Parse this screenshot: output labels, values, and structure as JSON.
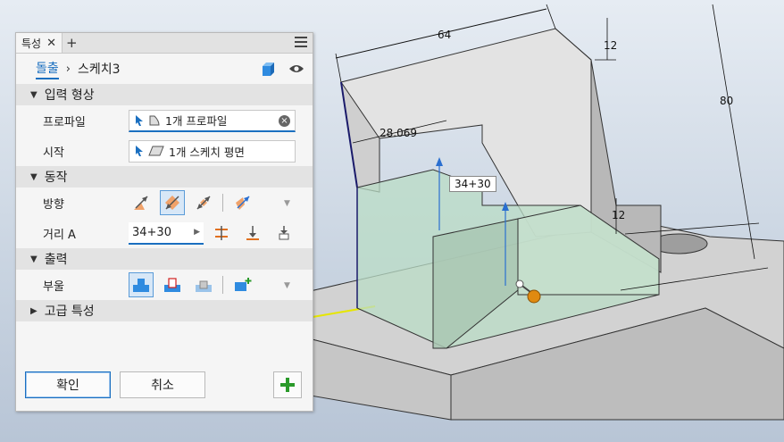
{
  "panel": {
    "tab_label": "특성",
    "close_glyph": "✕",
    "add_tab_glyph": "+",
    "breadcrumb": {
      "feature": "돌출",
      "separator": "›",
      "sketch": "스케치3"
    }
  },
  "sections": {
    "input_geometry": "입력 형상",
    "behavior": "동작",
    "output": "출력",
    "advanced": "고급 특성"
  },
  "input_geometry": {
    "profile_label": "프로파일",
    "profile_value": "1개 프로파일",
    "start_label": "시작",
    "start_value": "1개 스케치 평면"
  },
  "behavior": {
    "direction_label": "방향",
    "distance_label": "거리 A",
    "distance_value": "34+30"
  },
  "output": {
    "boolean_label": "부울"
  },
  "footer": {
    "ok_label": "확인",
    "cancel_label": "취소",
    "add_glyph": "+"
  },
  "viewport": {
    "dims": {
      "width_top": "64",
      "top_thickness": "12",
      "overall_height": "80",
      "offset": "28.069",
      "step_height": "12",
      "extrude_value": "34+30"
    }
  },
  "colors": {
    "accent": "#1a6fc0",
    "preview_fill": "#b9dcc6",
    "part_face": "#d8d8d8",
    "handle": "#e08a10"
  },
  "icons": {
    "cube": "cube-icon",
    "eye": "eye-icon",
    "cursor": "select-cursor-icon",
    "profile": "profile-icon",
    "plane": "plane-icon"
  }
}
